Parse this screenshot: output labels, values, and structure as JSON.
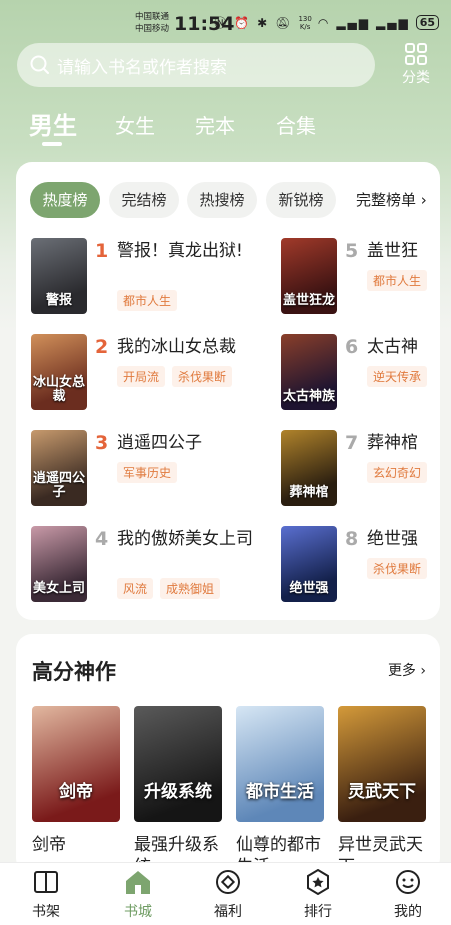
{
  "status_bar": {
    "carrier1": "中国联通",
    "carrier2": "中国移动",
    "time": "11:54",
    "net_speed_value": "130",
    "net_speed_unit": "K/s",
    "battery": "65"
  },
  "search": {
    "placeholder": "请输入书名或作者搜索"
  },
  "category_button": {
    "label": "分类"
  },
  "gender_tabs": [
    "男生",
    "女生",
    "完本",
    "合集"
  ],
  "gender_tabs_selected": 0,
  "rank_chips": [
    "热度榜",
    "完结榜",
    "热搜榜",
    "新锐榜"
  ],
  "rank_chips_selected": 0,
  "rank_more": "完整榜单",
  "ranking": [
    {
      "rank": "1",
      "name": "警报！真龙出狱!",
      "tags": [
        "都市人生"
      ],
      "cover_text": "警报",
      "cover_colors": [
        "#2a2a2e",
        "#6b6f76"
      ]
    },
    {
      "rank": "2",
      "name": "我的冰山女总裁",
      "tags": [
        "开局流",
        "杀伐果断"
      ],
      "cover_text": "冰山女总裁",
      "cover_colors": [
        "#6b2d1f",
        "#d1905a"
      ]
    },
    {
      "rank": "3",
      "name": "逍遥四公子",
      "tags": [
        "军事历史"
      ],
      "cover_text": "逍遥四公子",
      "cover_colors": [
        "#3a2a22",
        "#c79a6d"
      ]
    },
    {
      "rank": "4",
      "name": "我的傲娇美女上司",
      "tags": [
        "风流",
        "成熟御姐"
      ],
      "cover_text": "美女上司",
      "cover_colors": [
        "#3b2a36",
        "#c99aa8"
      ]
    },
    {
      "rank": "5",
      "name": "盖世狂",
      "tags": [
        "都市人生"
      ],
      "cover_text": "盖世狂龙",
      "cover_colors": [
        "#3a1212",
        "#a13a2a"
      ]
    },
    {
      "rank": "6",
      "name": "太古神",
      "tags": [
        "逆天传承"
      ],
      "cover_text": "太古神族",
      "cover_colors": [
        "#1e1430",
        "#8a3f2a"
      ]
    },
    {
      "rank": "7",
      "name": "葬神棺",
      "tags": [
        "玄幻奇幻"
      ],
      "cover_text": "葬神棺",
      "cover_colors": [
        "#2a1e10",
        "#b0832b"
      ]
    },
    {
      "rank": "8",
      "name": "绝世强",
      "tags": [
        "杀伐果断"
      ],
      "cover_text": "绝世强",
      "cover_colors": [
        "#13204a",
        "#5a6fd0"
      ]
    }
  ],
  "rank_num_colors": [
    "#e4643a",
    "#e4643a",
    "#e4643a",
    "#aaaaaa",
    "#aaaaaa",
    "#aaaaaa",
    "#aaaaaa",
    "#aaaaaa"
  ],
  "high_score": {
    "title": "高分神作",
    "more": "更多",
    "books": [
      {
        "name": "剑帝",
        "cover_text": "剑帝",
        "cover_colors": [
          "#7a1a1a",
          "#e2b8a0"
        ]
      },
      {
        "name": "最强升级系统",
        "cover_text": "升级系统",
        "cover_colors": [
          "#151515",
          "#5a5a5a"
        ]
      },
      {
        "name": "仙尊的都市生活",
        "cover_text": "都市生活",
        "cover_colors": [
          "#5e87b8",
          "#d6e6f4"
        ]
      },
      {
        "name": "异世灵武天下",
        "cover_text": "灵武天下",
        "cover_colors": [
          "#3a1f10",
          "#d49a3a"
        ]
      }
    ]
  },
  "bottom_nav": [
    "书架",
    "书城",
    "福利",
    "排行",
    "我的"
  ],
  "bottom_nav_selected": 1,
  "accent_color": "#7da56f"
}
